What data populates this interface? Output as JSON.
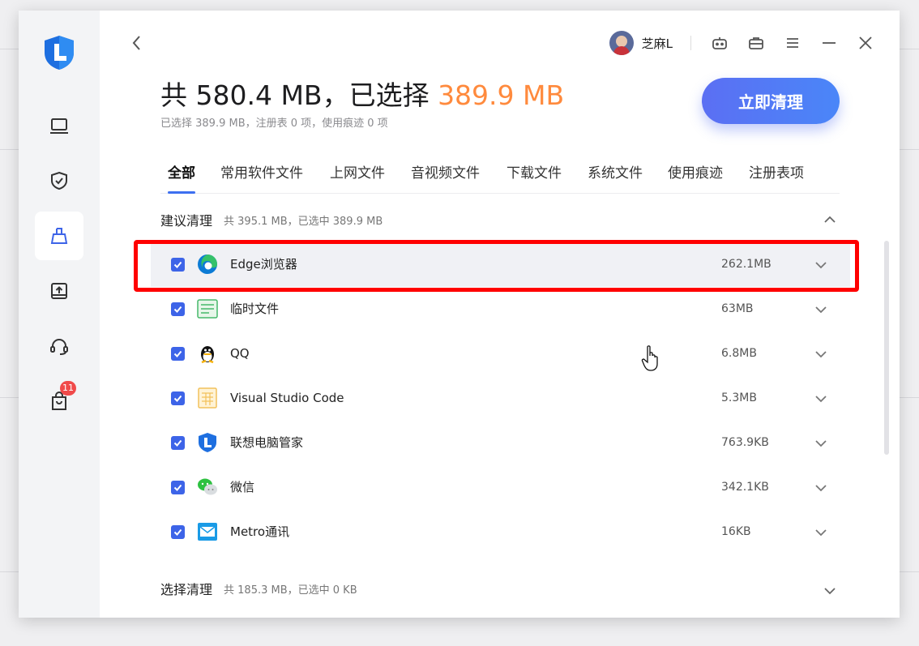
{
  "window": {
    "user": {
      "name": "芝麻L"
    },
    "headline": {
      "prefix": "共 580.4 MB，已选择 ",
      "highlight": "389.9 MB"
    },
    "subline": "已选择 389.9 MB，注册表 0 项，使用痕迹 0 项",
    "clean_button": "立即清理"
  },
  "sidebar": {
    "items": [
      {
        "name": "computer",
        "icon": "monitor-icon"
      },
      {
        "name": "security",
        "icon": "shield-icon"
      },
      {
        "name": "cleanup",
        "icon": "broom-icon",
        "active": true
      },
      {
        "name": "drivers",
        "icon": "upload-drive-icon"
      },
      {
        "name": "support",
        "icon": "headset-icon"
      },
      {
        "name": "store",
        "icon": "bag-icon",
        "badge": "11"
      }
    ]
  },
  "tabs": [
    "全部",
    "常用软件文件",
    "上网文件",
    "音视频文件",
    "下载文件",
    "系统文件",
    "使用痕迹",
    "注册表项"
  ],
  "sections": {
    "recommended": {
      "title": "建议清理",
      "meta": "共 395.1 MB，已选中 389.9 MB"
    },
    "optional": {
      "title": "选择清理",
      "meta": "共 185.3 MB，已选中 0 KB"
    }
  },
  "rows": [
    {
      "name": "Edge浏览器",
      "size": "262.1MB",
      "icon": "edge-icon",
      "checked": true
    },
    {
      "name": "临时文件",
      "size": "63MB",
      "icon": "temp-file-icon",
      "checked": true
    },
    {
      "name": "QQ",
      "size": "6.8MB",
      "icon": "qq-icon",
      "checked": true
    },
    {
      "name": "Visual Studio Code",
      "size": "5.3MB",
      "icon": "vscode-file-icon",
      "checked": true
    },
    {
      "name": "联想电脑管家",
      "size": "763.9KB",
      "icon": "lenovo-manager-icon",
      "checked": true
    },
    {
      "name": "微信",
      "size": "342.1KB",
      "icon": "wechat-icon",
      "checked": true
    },
    {
      "name": "Metro通讯",
      "size": "16KB",
      "icon": "mail-icon",
      "checked": true
    }
  ],
  "colors": {
    "accent": "#3d64e8",
    "highlight": "#ff8a3d",
    "annotation": "#ff0000"
  }
}
